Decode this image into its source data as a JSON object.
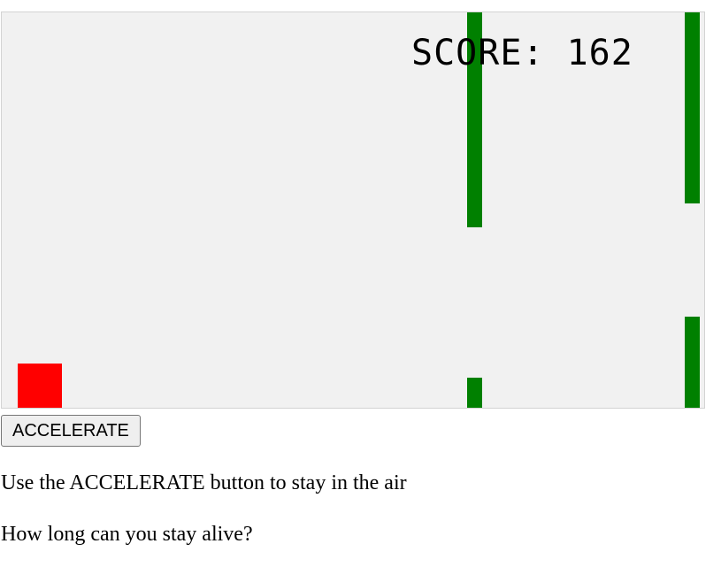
{
  "game": {
    "score_label": "SCORE: 162",
    "background_color": "#f1f1f1",
    "player_color": "#ff0000",
    "obstacle_color": "#008000"
  },
  "controls": {
    "accelerate_label": "ACCELERATE"
  },
  "instructions": {
    "line1": "Use the ACCELERATE button to stay in the air",
    "line2": "How long can you stay alive?"
  }
}
